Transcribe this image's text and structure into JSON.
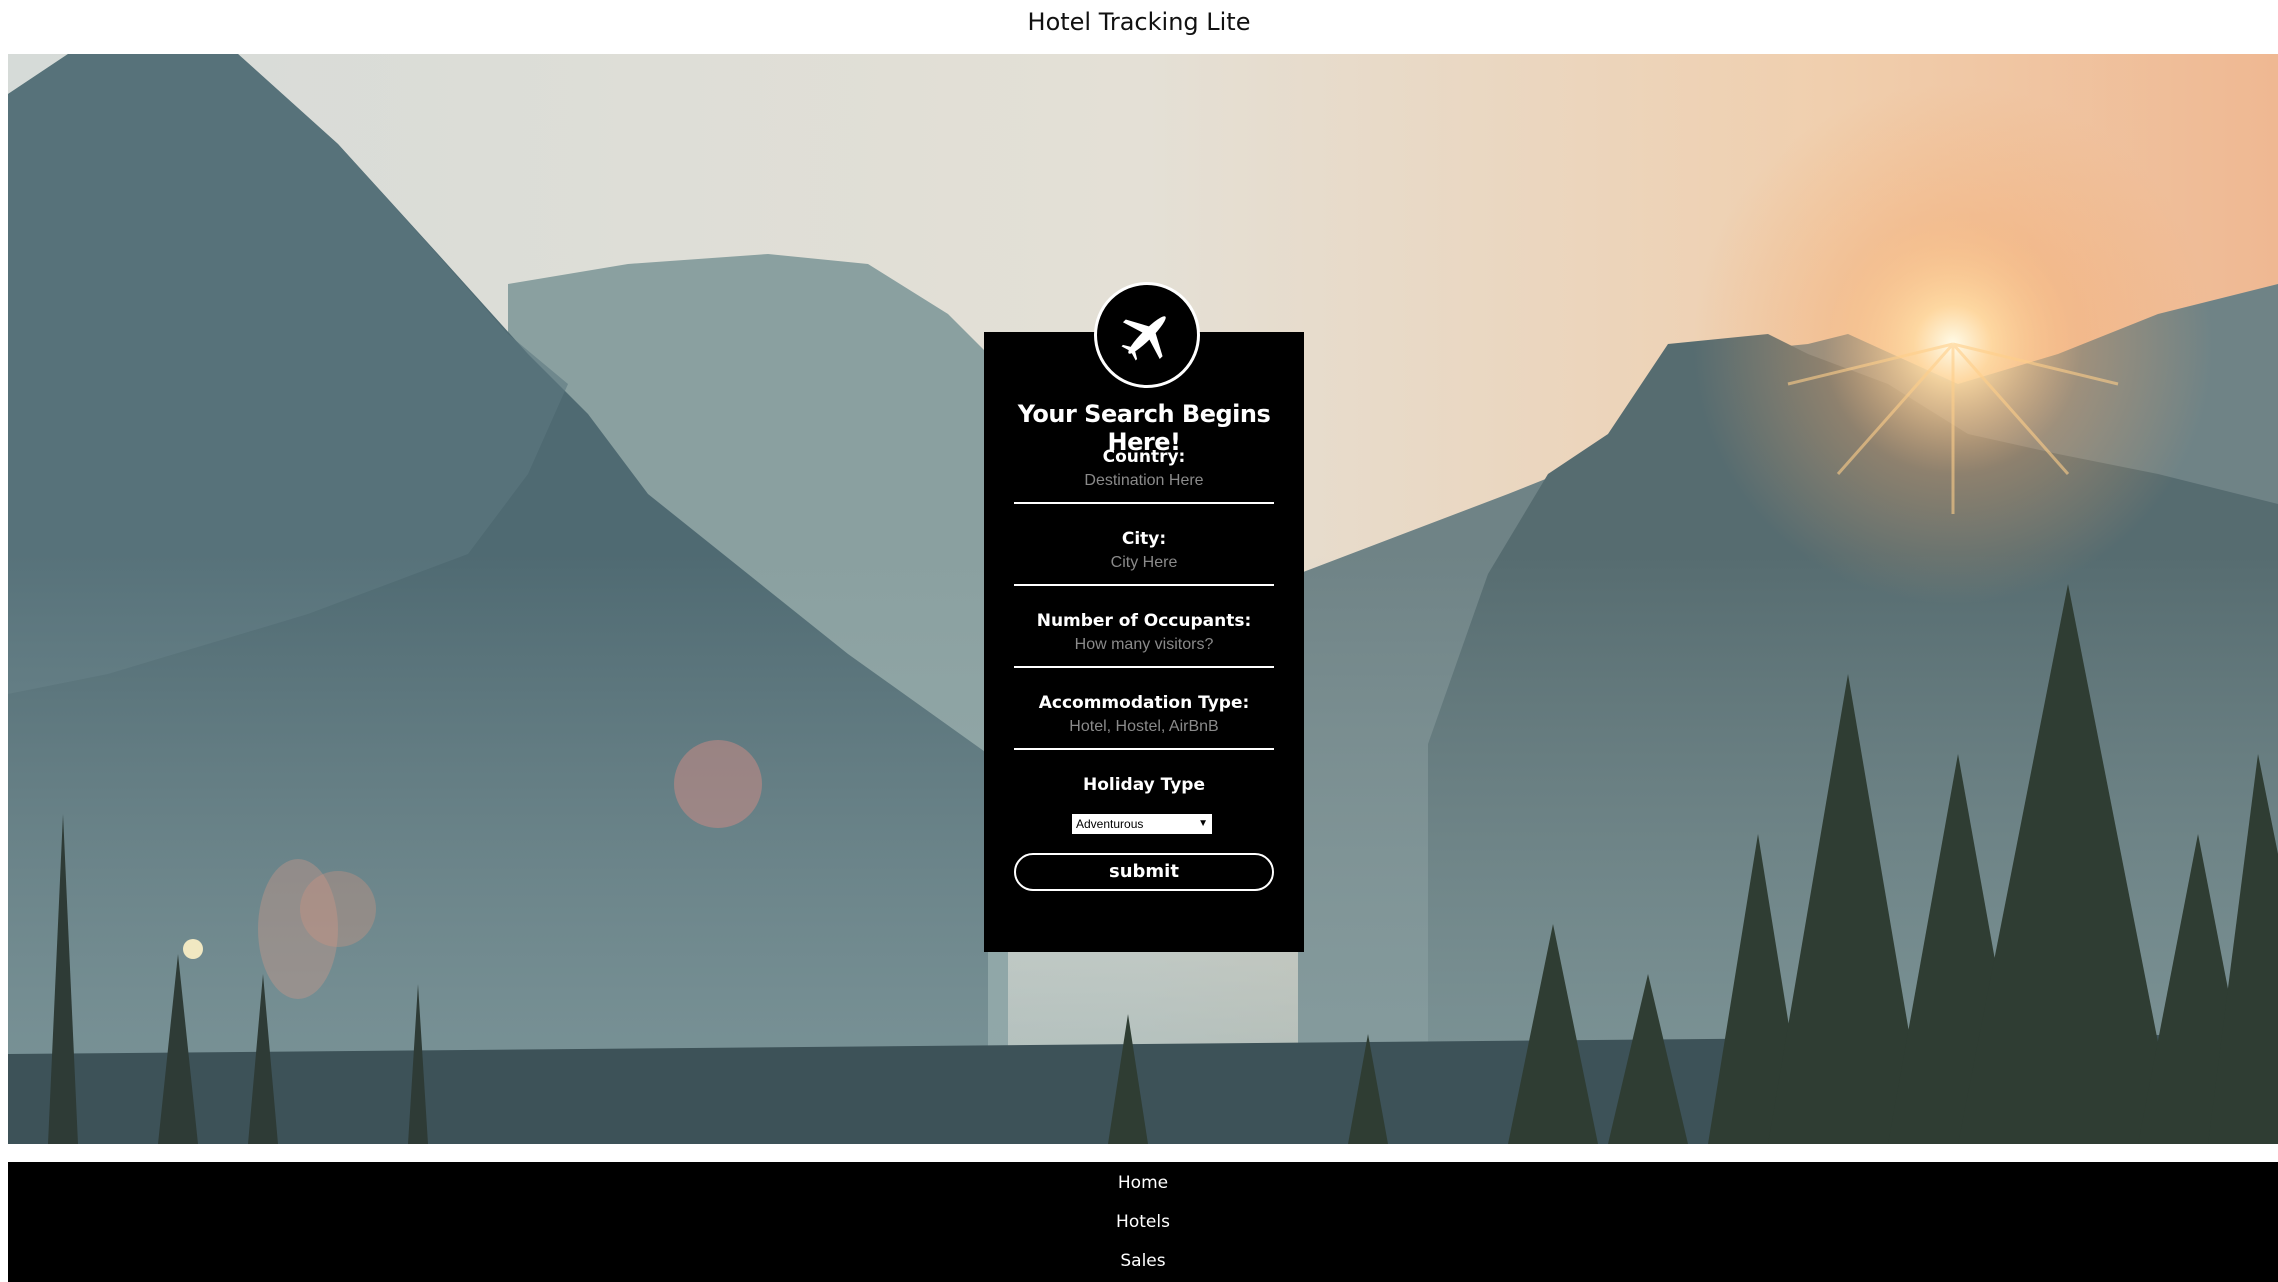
{
  "site": {
    "title": "Hotel Tracking Lite"
  },
  "hero": {
    "icon": "mountain-landscape-photo"
  },
  "search_card": {
    "icon": "airplane-icon",
    "heading": "Your Search Begins Here!",
    "fields": [
      {
        "label": "Country:",
        "placeholder": "Destination Here",
        "value": ""
      },
      {
        "label": "City:",
        "placeholder": "City Here",
        "value": ""
      },
      {
        "label": "Number of Occupants:",
        "placeholder": "How many visitors?",
        "value": ""
      },
      {
        "label": "Accommodation Type:",
        "placeholder": "Hotel, Hostel, AirBnB",
        "value": ""
      }
    ],
    "holiday_type": {
      "label": "Holiday Type",
      "selected": "Adventurous"
    },
    "submit_label": "submit"
  },
  "footer_nav": {
    "items": [
      {
        "label": "Home"
      },
      {
        "label": "Hotels"
      },
      {
        "label": "Sales"
      }
    ]
  }
}
